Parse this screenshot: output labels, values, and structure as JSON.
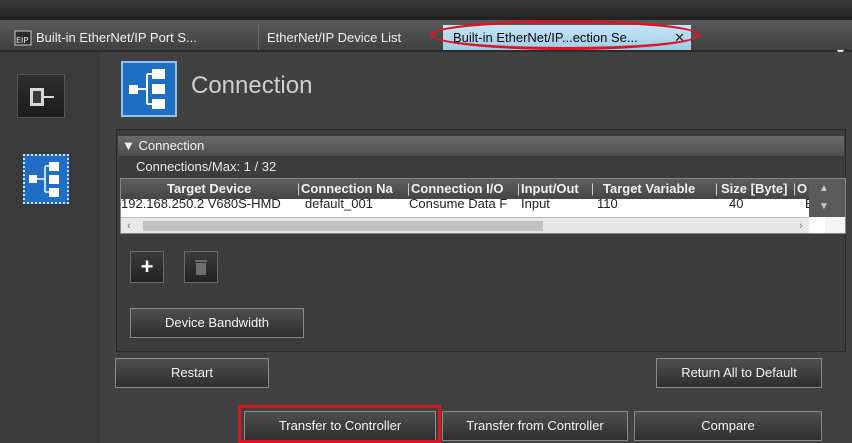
{
  "tabs": [
    {
      "label": "Built-in EtherNet/IP Port S...",
      "icon": "eip-icon",
      "active": false
    },
    {
      "label": "EtherNet/IP Device List",
      "active": false
    },
    {
      "label": "Built-in EtherNet/IP...ection Se...",
      "active": true,
      "closable": true
    }
  ],
  "tab_menu_icon": "▾",
  "page": {
    "title": "Connection",
    "icon": "connection-tree-icon"
  },
  "rail": {
    "items": [
      {
        "icon": "device-port-icon"
      },
      {
        "icon": "connection-tree-icon",
        "selected": true
      }
    ]
  },
  "connection_panel": {
    "header": "Connection",
    "count_label": "Connections/Max: 1 / 32",
    "columns": [
      "Target Device",
      "Connection Na",
      "Connection I/O",
      "Input/Out",
      "Target Variable",
      "Size [Byte]",
      "O"
    ],
    "rows": [
      [
        "192.168.250.2 V680S-HMD",
        "default_001",
        "Consume Data F",
        "Input",
        "110",
        "40",
        "EIP"
      ]
    ]
  },
  "buttons": {
    "add": "+",
    "delete_icon": "trash-icon",
    "device_bandwidth": "Device Bandwidth",
    "restart": "Restart",
    "return_all": "Return All to Default",
    "transfer_to": "Transfer to Controller",
    "transfer_from": "Transfer from Controller",
    "compare": "Compare"
  },
  "colors": {
    "highlight": "#e0141e",
    "active_tab": "#b3daf2",
    "icon_blue": "#1e6fc4"
  }
}
